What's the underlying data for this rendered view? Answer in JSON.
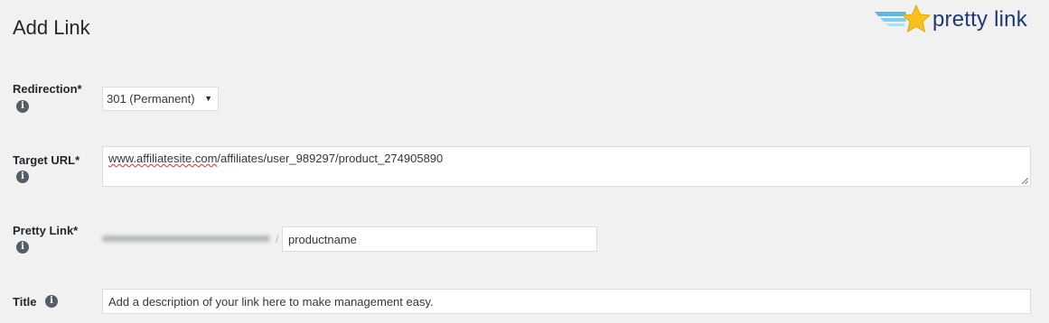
{
  "page": {
    "title": "Add Link"
  },
  "logo": {
    "text": "pretty link",
    "icon": "star-logo-icon",
    "colors": {
      "star": "#f6c21b",
      "wing": "#3fb6e8",
      "text": "#1f3a73"
    }
  },
  "form": {
    "redirection": {
      "label": "Redirection*",
      "info_icon": "info-icon",
      "selected": "301 (Permanent)"
    },
    "target_url": {
      "label": "Target URL*",
      "info_icon": "info-icon",
      "value_domain": "www.affiliatesite.com",
      "value_path": "/affiliates/user_989297/product_274905890"
    },
    "pretty_link": {
      "label": "Pretty Link*",
      "info_icon": "info-icon",
      "separator": "/",
      "slug": "productname"
    },
    "title": {
      "label": "Title",
      "info_icon": "info-icon",
      "value": "Add a description of your link here to make management easy."
    }
  }
}
